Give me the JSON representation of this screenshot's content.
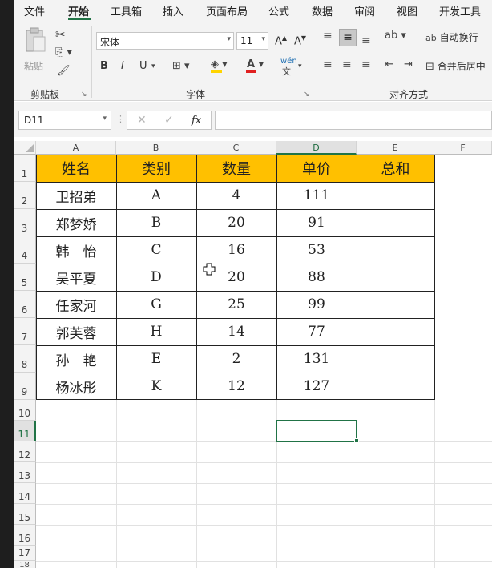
{
  "ribbon_tabs": [
    "文件",
    "开始",
    "工具箱",
    "插入",
    "页面布局",
    "公式",
    "数据",
    "审阅",
    "视图",
    "开发工具"
  ],
  "active_tab": "开始",
  "clipboard": {
    "paste_label": "粘贴",
    "group_label": "剪贴板"
  },
  "font": {
    "name": "宋体",
    "size": "11",
    "bold": "B",
    "italic": "I",
    "underline": "U",
    "group_label": "字体",
    "pinyin": "wén"
  },
  "alignment": {
    "wrap_label": "自动换行",
    "merge_label": "合并后居中",
    "group_label": "对齐方式"
  },
  "formula_bar": {
    "name_box": "D11",
    "fx": "fx",
    "value": ""
  },
  "columns": [
    "A",
    "B",
    "C",
    "D",
    "E",
    "F"
  ],
  "selected_column": "D",
  "rows": [
    "1",
    "2",
    "3",
    "4",
    "5",
    "6",
    "7",
    "8",
    "9",
    "10",
    "11",
    "12",
    "13",
    "14",
    "15",
    "16",
    "17",
    "18"
  ],
  "selected_row": "11",
  "table": {
    "headers": [
      "姓名",
      "类别",
      "数量",
      "单价",
      "总和"
    ],
    "rows": [
      [
        "卫招弟",
        "A",
        "4",
        "111",
        ""
      ],
      [
        "郑梦娇",
        "B",
        "20",
        "91",
        ""
      ],
      [
        "韩　怡",
        "C",
        "16",
        "53",
        ""
      ],
      [
        "吴平夏",
        "D",
        "20",
        "88",
        ""
      ],
      [
        "任家河",
        "G",
        "25",
        "99",
        ""
      ],
      [
        "郭芙蓉",
        "H",
        "14",
        "77",
        ""
      ],
      [
        "孙　艳",
        "E",
        "2",
        "131",
        ""
      ],
      [
        "杨冰彤",
        "K",
        "12",
        "127",
        ""
      ]
    ]
  },
  "header_fill_color": "#FFC000",
  "selection_color": "#217346",
  "selected_cell": "D11"
}
